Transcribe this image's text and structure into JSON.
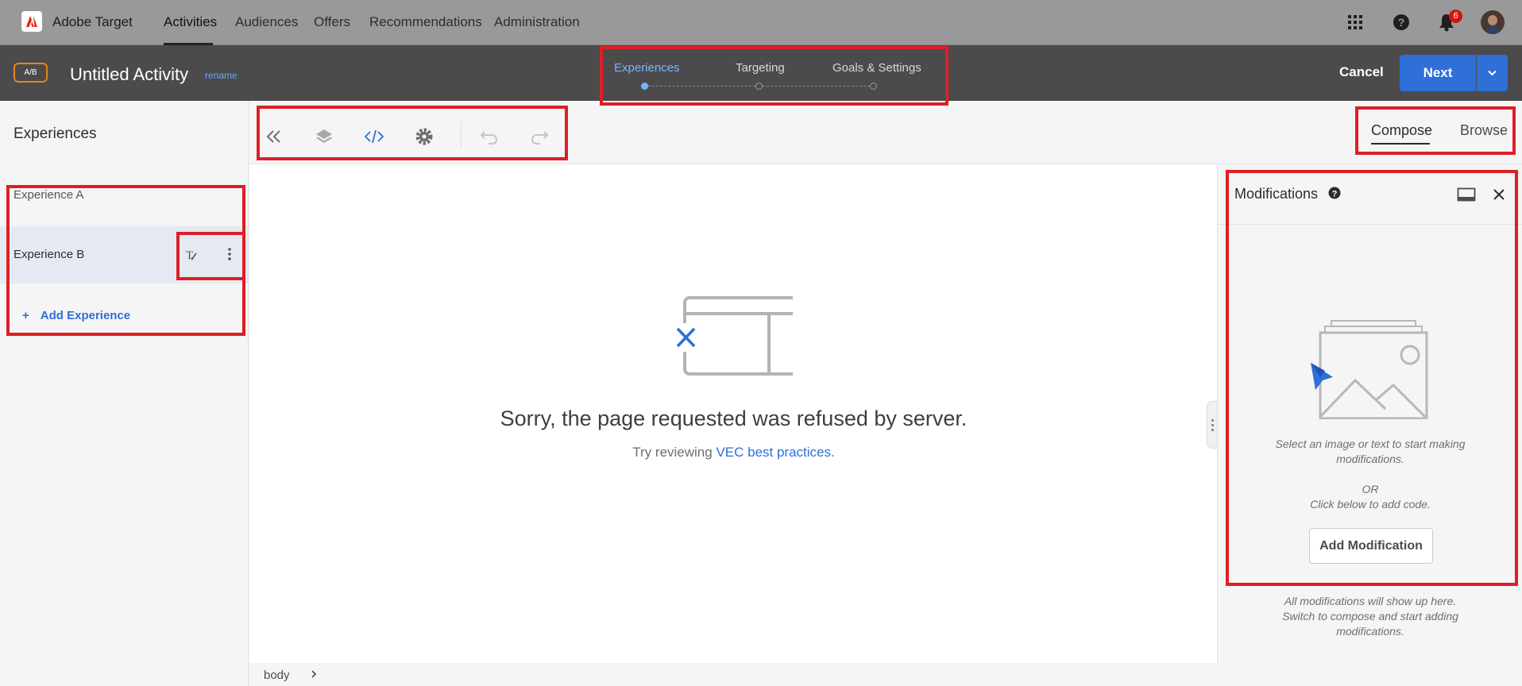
{
  "topnav": {
    "app_title": "Adobe Target",
    "items": [
      {
        "label": "Activities",
        "active": true
      },
      {
        "label": "Audiences"
      },
      {
        "label": "Offers"
      },
      {
        "label": "Recommendations"
      },
      {
        "label": "Administration"
      }
    ],
    "icons": [
      "apps-grid-icon",
      "help-icon",
      "bell-icon",
      "avatar"
    ],
    "notification_count": "6"
  },
  "activity": {
    "type_badge": "A/B",
    "title": "Untitled Activity",
    "rename_label": "rename",
    "steps": [
      {
        "label": "Experiences",
        "active": true
      },
      {
        "label": "Targeting"
      },
      {
        "label": "Goals & Settings"
      }
    ],
    "cancel_label": "Cancel",
    "next_label": "Next"
  },
  "experiences": {
    "title": "Experiences",
    "items": [
      {
        "label": "Experience A"
      },
      {
        "label": "Experience B",
        "selected": true
      }
    ],
    "add_label": "Add Experience"
  },
  "toolbar": {
    "icons": [
      "collapse-left-icon",
      "layers-icon",
      "code-icon",
      "settings-icon",
      "undo-icon",
      "redo-icon"
    ],
    "modes": [
      {
        "label": "Compose",
        "active": true
      },
      {
        "label": "Browse"
      }
    ]
  },
  "canvas": {
    "error_message": "Sorry, the page requested was refused by server.",
    "hint_prefix": "Try reviewing ",
    "hint_link": "VEC best practices",
    "hint_suffix": "."
  },
  "breadcrumb": {
    "items": [
      "body"
    ]
  },
  "modifications": {
    "title": "Modifications",
    "note_line1": "Select an image or text to start making modifications.",
    "or_label": "OR",
    "note_line2": "Click below to add code.",
    "add_button": "Add Modification",
    "footer_note": "All modifications will show up here. Switch to compose and start adding modifications."
  },
  "colors": {
    "accent": "#2e6fd8",
    "annotation": "#dc1f26",
    "header_bg": "#4b4b4b",
    "topnav_bg": "#999999"
  }
}
